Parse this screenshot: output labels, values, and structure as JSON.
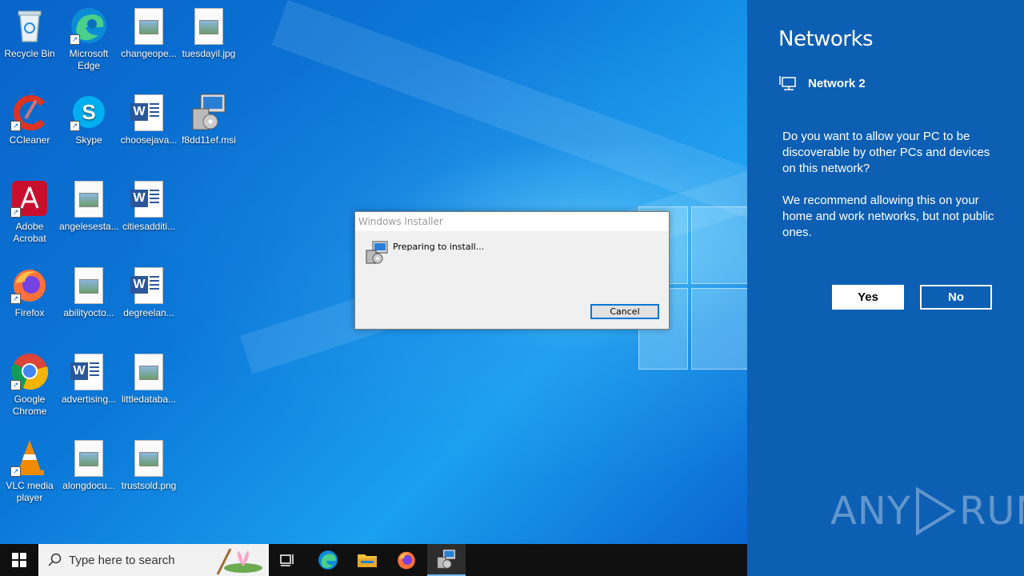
{
  "desktop": {
    "icons": [
      {
        "label": "Recycle Bin"
      },
      {
        "label": "Microsoft Edge"
      },
      {
        "label": "changeope..."
      },
      {
        "label": "tuesdayil.jpg"
      },
      {
        "label": "CCleaner"
      },
      {
        "label": "Skype"
      },
      {
        "label": "choosejava..."
      },
      {
        "label": "f8dd11ef.msi"
      },
      {
        "label": "Adobe Acrobat"
      },
      {
        "label": "angelesesta..."
      },
      {
        "label": "citiesadditi..."
      },
      {
        "label": "Firefox"
      },
      {
        "label": "abilityocto..."
      },
      {
        "label": "degreelan..."
      },
      {
        "label": "Google Chrome"
      },
      {
        "label": "advertising..."
      },
      {
        "label": "littledataba..."
      },
      {
        "label": "VLC media player"
      },
      {
        "label": "alongdocu..."
      },
      {
        "label": "trustsold.png"
      }
    ]
  },
  "installer_dialog": {
    "title": "Windows Installer",
    "message": "Preparing to install...",
    "cancel_label": "Cancel"
  },
  "taskbar": {
    "search_placeholder": "Type here to search"
  },
  "networks_panel": {
    "title": "Networks",
    "network_name": "Network 2",
    "question": "Do you want to allow your PC to be discoverable by other PCs and devices on this network?",
    "recommendation": "We recommend allowing this on your home and work networks, but not public ones.",
    "yes_label": "Yes",
    "no_label": "No"
  },
  "watermark": {
    "text_left": "ANY",
    "text_right": "RUN"
  },
  "colors": {
    "panel_bg": "#0d5fb3",
    "accent": "#0078d7",
    "taskbar_bg": "#101010"
  }
}
